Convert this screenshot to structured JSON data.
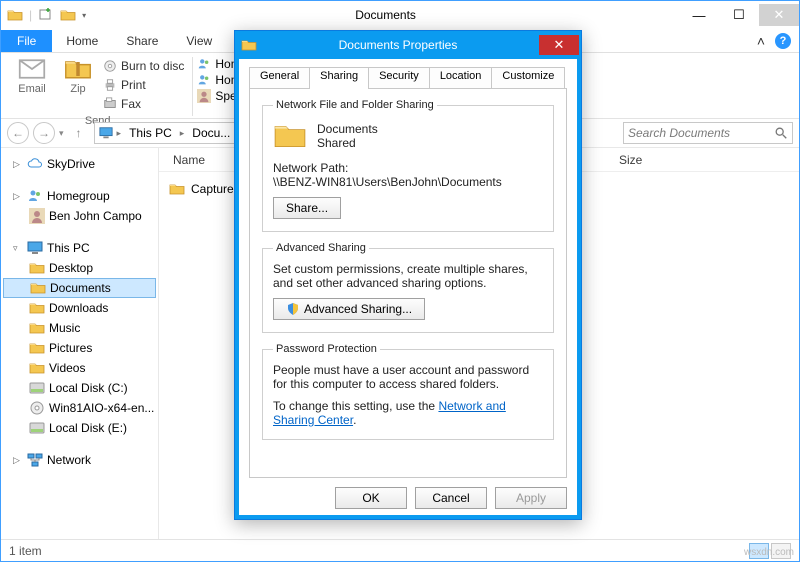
{
  "titlebar": {
    "title": "Documents"
  },
  "ribbon": {
    "tabs": {
      "file": "File",
      "home": "Home",
      "share": "Share",
      "view": "View"
    },
    "email": "Email",
    "zip": "Zip",
    "burn": "Burn to disc",
    "print": "Print",
    "fax": "Fax",
    "group_send": "Send",
    "share_with": [
      "Hom...",
      "Hom...",
      "Spe..."
    ]
  },
  "breadcrumb": {
    "pc": "This PC",
    "docs": "Docu..."
  },
  "search": {
    "placeholder": "Search Documents"
  },
  "columns": {
    "name": "Name",
    "size": "Size"
  },
  "tree": {
    "skydrive": "SkyDrive",
    "homegroup": "Homegroup",
    "homegroup_user": "Ben John Campo",
    "thispc": "This PC",
    "desktop": "Desktop",
    "documents": "Documents",
    "downloads": "Downloads",
    "music": "Music",
    "pictures": "Pictures",
    "videos": "Videos",
    "localc": "Local Disk (C:)",
    "win81": "Win81AIO-x64-en...",
    "locale": "Local Disk (E:)",
    "network": "Network"
  },
  "files": {
    "capture": "Capture..."
  },
  "status": {
    "items": "1 item"
  },
  "dialog": {
    "title": "Documents Properties",
    "tabs": {
      "general": "General",
      "sharing": "Sharing",
      "security": "Security",
      "location": "Location",
      "customize": "Customize"
    },
    "nfs_legend": "Network File and Folder Sharing",
    "folder_name": "Documents",
    "folder_state": "Shared",
    "netpath_label": "Network Path:",
    "netpath_value": "\\\\BENZ-WIN81\\Users\\BenJohn\\Documents",
    "share_btn": "Share...",
    "adv_legend": "Advanced Sharing",
    "adv_text": "Set custom permissions, create multiple shares, and set other advanced sharing options.",
    "adv_btn": "Advanced Sharing...",
    "pwd_legend": "Password Protection",
    "pwd_text": "People must have a user account and password for this computer to access shared folders.",
    "pwd_change_prefix": "To change this setting, use the ",
    "pwd_link": "Network and Sharing Center",
    "ok": "OK",
    "cancel": "Cancel",
    "apply": "Apply"
  },
  "watermark": "wsxdn.com"
}
